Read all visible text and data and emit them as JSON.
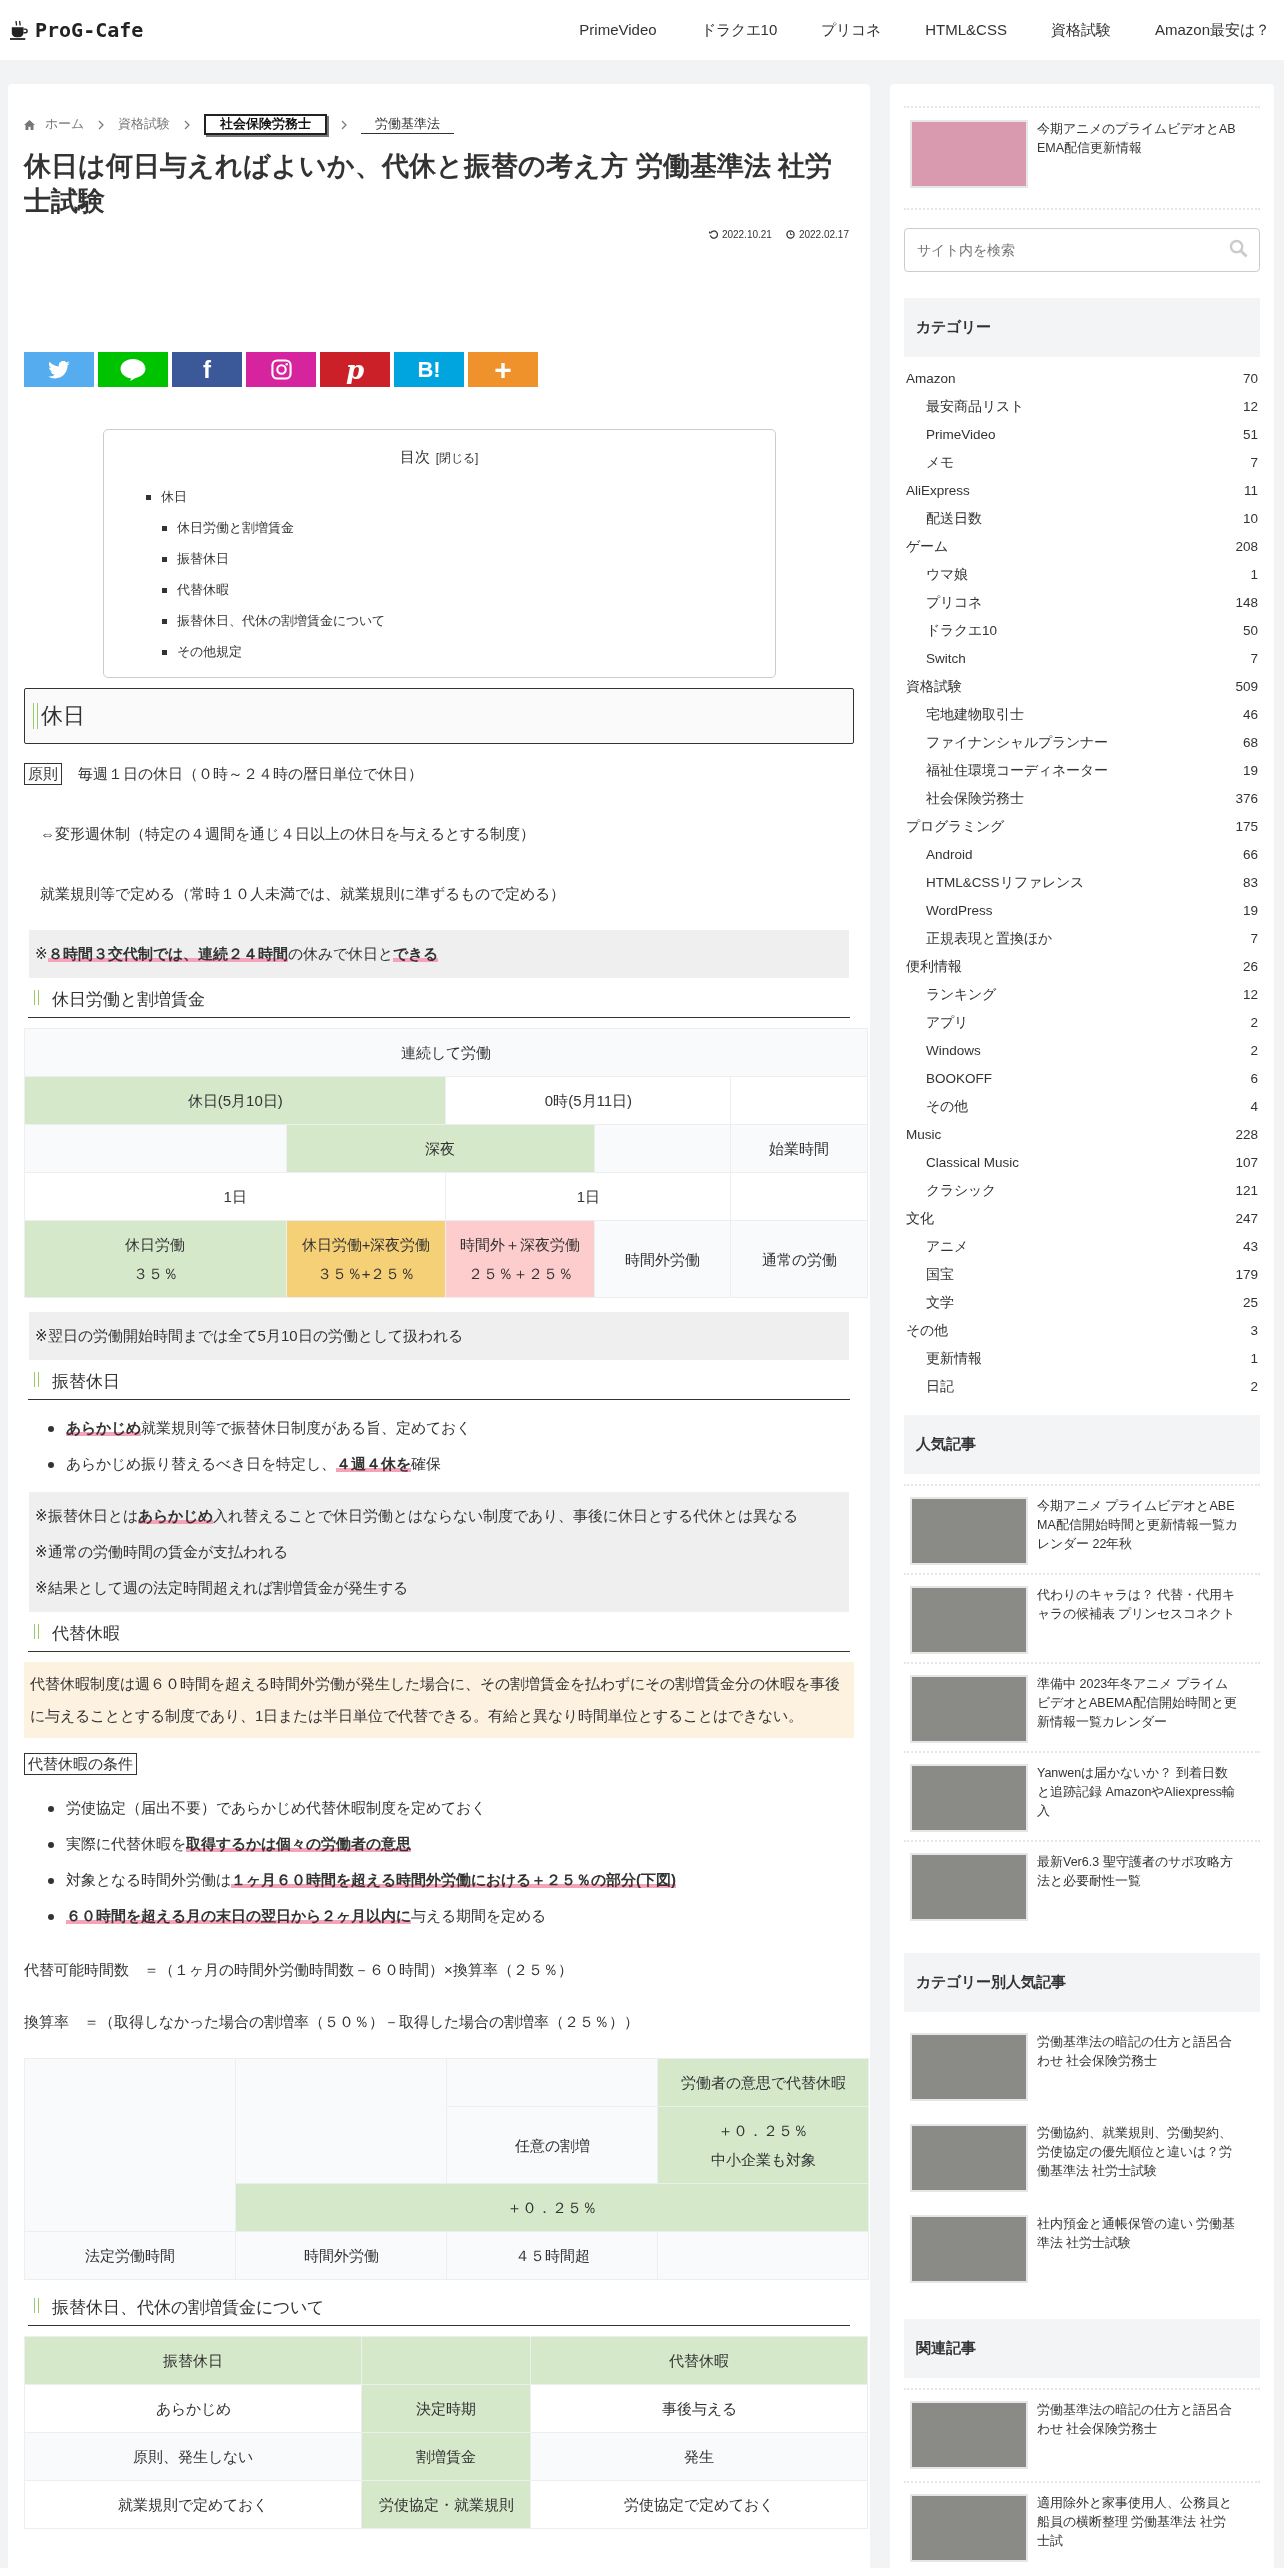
{
  "header": {
    "logo": "ProG-Cafe",
    "nav": [
      "PrimeVideo",
      "ドラクエ10",
      "プリコネ",
      "HTML&CSS",
      "資格試験",
      "Amazon最安は？"
    ]
  },
  "breadcrumb": [
    {
      "label": "ホーム",
      "kind": "home"
    },
    {
      "label": "資格試験",
      "kind": "plain"
    },
    {
      "label": "社会保険労務士",
      "kind": "boxed"
    },
    {
      "label": "労働基準法",
      "kind": "underlined"
    }
  ],
  "article": {
    "title": "休日は何日与えればよいか、代休と振替の考え方 労働基準法 社労士試験",
    "updated": "2022.10.21",
    "published": "2022.02.17",
    "share": [
      {
        "kind": "twitter",
        "color": "#55acee"
      },
      {
        "kind": "line",
        "color": "#00c300"
      },
      {
        "kind": "facebook",
        "color": "#3b5998",
        "label": "f"
      },
      {
        "kind": "instagram",
        "color": "#d6249f"
      },
      {
        "kind": "pinterest",
        "color": "#cb2027",
        "label": "p"
      },
      {
        "kind": "hatena",
        "color": "#00a4de",
        "label": "B!"
      },
      {
        "kind": "more",
        "color": "#f0922b",
        "label": "+"
      }
    ],
    "toc": {
      "title": "目次",
      "toggle": "[閉じる]",
      "items": [
        {
          "label": "休日",
          "children": [
            {
              "label": "休日労働と割増賃金"
            },
            {
              "label": "振替休日"
            },
            {
              "label": "代替休暇"
            },
            {
              "label": "振替休日、代休の割増賃金について"
            },
            {
              "label": "その他規定"
            }
          ]
        }
      ]
    },
    "content": [
      {
        "kind": "h2",
        "text": "休日"
      },
      {
        "kind": "p",
        "label": "原則",
        "text": "毎週１日の休日（０時～２４時の暦日単位で休日）"
      },
      {
        "kind": "indent",
        "text": "⇔変形週休制（特定の４週間を通じ４日以上の休日を与えるとする制度）"
      },
      {
        "kind": "indent",
        "text": "就業規則等で定める（常時１０人未満では、就業規則に準ずるもので定める）"
      },
      {
        "kind": "note",
        "lines": [
          "※**８時間３交代制では、連続２４時間**の休みで休日と**できる**"
        ]
      },
      {
        "kind": "h3",
        "text": "休日労働と割増賃金"
      },
      {
        "kind": "table",
        "rows": [
          [
            {
              "text": "連続して労働",
              "colspan": 5
            }
          ],
          [
            {
              "text": "休日(5月10日)",
              "colspan": 2,
              "color": "#d5e8ca"
            },
            {
              "text": "0時(5月11日)",
              "colspan": 2
            },
            {}
          ],
          [
            {},
            {
              "text": "深夜",
              "colspan": 2,
              "color": "#d5e8ca"
            },
            {},
            {
              "text": "始業時間"
            }
          ],
          [
            {
              "text": "1日",
              "colspan": 2
            },
            {
              "text": "1日",
              "colspan": 2
            },
            {}
          ],
          [
            {
              "lines": [
                "休日労働",
                "３５％"
              ],
              "color": "#d5e8ca"
            },
            {
              "lines": [
                "休日労働+深夜労働",
                "３５％+２５％"
              ],
              "color": "#f6d077"
            },
            {
              "lines": [
                "時間外＋深夜労働",
                "２５％＋２５％"
              ],
              "color": "#fdcccc"
            },
            {
              "text": "時間外労働"
            },
            {
              "text": "通常の労働"
            }
          ]
        ]
      },
      {
        "kind": "note",
        "lines": [
          "※翌日の労働開始時間までは全て5月10日の労働として扱われる"
        ]
      },
      {
        "kind": "h3",
        "text": "振替休日"
      },
      {
        "kind": "list",
        "items": [
          "**あらかじめ**就業規則等で振替休日制度がある旨、定めておく",
          "あらかじめ振り替えるべき日を特定し、**４週４休を**確保"
        ]
      },
      {
        "kind": "note",
        "lines": [
          "※振替休日とは**あらかじめ**入れ替えることで休日労働とはならない制度であり、事後に休日とする代休とは異なる",
          "※通常の労働時間の賃金が支払われる",
          "※結果として週の法定時間超えれば割増賃金が発生する"
        ]
      },
      {
        "kind": "h3",
        "text": "代替休暇"
      },
      {
        "kind": "box",
        "text": "代替休暇制度は週６０時間を超える時間外労働が発生した場合に、その割増賃金を払わずにその割増賃金分の休暇を事後に与えることとする制度であり、1日または半日単位で代替できる。有給と異なり時間単位とすることはできない。"
      },
      {
        "kind": "tag",
        "text": "代替休暇の条件"
      },
      {
        "kind": "list",
        "items": [
          "労使協定（届出不要）であらかじめ代替休暇制度を定めておく",
          "実際に代替休暇を**取得するかは個々の労働者の意思**",
          "対象となる時間外労働は**１ヶ月６０時間を超える時間外労働における＋２５％の部分(下図)**",
          "**６０時間を超える月の末日の翌日から２ヶ月以内に**与える期間を定める"
        ]
      },
      {
        "kind": "formula",
        "text": "代替可能時間数　＝（１ヶ月の時間外労働時間数－６０時間）×換算率（２５％）"
      },
      {
        "kind": "formula",
        "text": "換算率　＝（取得しなかった場合の割増率（５０％）－取得した場合の割増率（２５％））"
      },
      {
        "kind": "table",
        "rows": [
          [
            {
              "rowspan": 4
            },
            {
              "rowspan": 3
            },
            {
              "rowspan": 2
            },
            {
              "text": "労働者の意思で代替休暇",
              "color": "#d5e8ca"
            }
          ],
          [
            {
              "lines": [
                "＋０．２５％",
                "中小企業も対象"
              ],
              "rowspan": 2,
              "color": "#d5e8ca"
            }
          ],
          [
            {
              "text": "任意の割増"
            }
          ],
          [
            {
              "text": "＋０．２５％",
              "colspan": 3,
              "color": "#d5e8ca"
            }
          ],
          [
            {
              "text": "法定労働時間"
            },
            {
              "text": "時間外労働"
            },
            {
              "text": "４５時間超"
            },
            {}
          ]
        ]
      },
      {
        "kind": "h3",
        "text": "振替休日、代休の割増賃金について"
      },
      {
        "kind": "table",
        "rows": [
          [
            {
              "text": "振替休日",
              "color": "#d5e8ca"
            },
            {
              "color": "#d5e8ca"
            },
            {
              "text": "代替休暇",
              "color": "#d5e8ca"
            }
          ],
          [
            {
              "text": "あらかじめ"
            },
            {
              "text": "決定時期",
              "color": "#d5e8ca"
            },
            {
              "text": "事後与える"
            }
          ],
          [
            {
              "text": "原則、発生しない"
            },
            {
              "text": "割増賃金",
              "color": "#d5e8ca"
            },
            {
              "text": "発生"
            }
          ],
          [
            {
              "text": "就業規則で定めておく"
            },
            {
              "text": "労使協定・就業規則",
              "color": "#d5e8ca"
            },
            {
              "text": "労使協定で定めておく"
            }
          ]
        ]
      }
    ]
  },
  "sidebar": {
    "top_post": {
      "title": "今期アニメのプライムビデオとABEMA配信更新情報"
    },
    "search": {
      "placeholder": "サイト内を検索"
    },
    "categories": {
      "title": "カテゴリー",
      "items": [
        {
          "name": "Amazon",
          "count": "70",
          "children": [
            {
              "name": "最安商品リスト",
              "count": "12"
            },
            {
              "name": "PrimeVideo",
              "count": "51"
            },
            {
              "name": "メモ",
              "count": "7"
            }
          ]
        },
        {
          "name": "AliExpress",
          "count": "11",
          "children": [
            {
              "name": "配送日数",
              "count": "10"
            }
          ]
        },
        {
          "name": "ゲーム",
          "count": "208",
          "children": [
            {
              "name": "ウマ娘",
              "count": "1"
            },
            {
              "name": "プリコネ",
              "count": "148"
            },
            {
              "name": "ドラクエ10",
              "count": "50"
            },
            {
              "name": "Switch",
              "count": "7"
            }
          ]
        },
        {
          "name": "資格試験",
          "count": "509",
          "children": [
            {
              "name": "宅地建物取引士",
              "count": "46"
            },
            {
              "name": "ファイナンシャルプランナー",
              "count": "68"
            },
            {
              "name": "福祉住環境コーディネーター",
              "count": "19"
            },
            {
              "name": "社会保険労務士",
              "count": "376"
            }
          ]
        },
        {
          "name": "プログラミング",
          "count": "175",
          "children": [
            {
              "name": "Android",
              "count": "66"
            },
            {
              "name": "HTML&CSSリファレンス",
              "count": "83"
            },
            {
              "name": "WordPress",
              "count": "19"
            },
            {
              "name": "正規表現と置換ほか",
              "count": "7"
            }
          ]
        },
        {
          "name": "便利情報",
          "count": "26",
          "children": [
            {
              "name": "ランキング",
              "count": "12"
            },
            {
              "name": "アプリ",
              "count": "2"
            },
            {
              "name": "Windows",
              "count": "2"
            },
            {
              "name": "BOOKOFF",
              "count": "6"
            },
            {
              "name": "その他",
              "count": "4"
            }
          ]
        },
        {
          "name": "Music",
          "count": "228",
          "children": [
            {
              "name": "Classical Music",
              "count": "107"
            },
            {
              "name": "クラシック",
              "count": "121"
            }
          ]
        },
        {
          "name": "文化",
          "count": "247",
          "children": [
            {
              "name": "アニメ",
              "count": "43"
            },
            {
              "name": "国宝",
              "count": "179"
            },
            {
              "name": "文学",
              "count": "25"
            }
          ]
        },
        {
          "name": "その他",
          "count": "3",
          "children": [
            {
              "name": "更新情報",
              "count": "1"
            },
            {
              "name": "日記",
              "count": "2"
            }
          ]
        }
      ]
    },
    "popular": {
      "title": "人気記事",
      "items": [
        {
          "title": "今期アニメ プライムビデオとABEMA配信開始時間と更新情報一覧カレンダー 22年秋"
        },
        {
          "title": "代わりのキャラは？ 代替・代用キャラの候補表 プリンセスコネクト"
        },
        {
          "title": "準備中 2023年冬アニメ プライムビデオとABEMA配信開始時間と更新情報一覧カレンダー"
        },
        {
          "title": "Yanwenは届かないか？ 到着日数と追跡記録 AmazonやAliexpress輸入"
        },
        {
          "title": "最新Ver6.3 聖守護者のサポ攻略方法と必要耐性一覧"
        }
      ]
    },
    "category_popular": {
      "title": "カテゴリー別人気記事",
      "items": [
        {
          "title": "労働基準法の暗記の仕方と語呂合わせ 社会保険労務士"
        },
        {
          "title": "労働協約、就業規則、労働契約、労使協定の優先順位と違いは？労働基準法 社労士試験"
        },
        {
          "title": "社内預金と通帳保管の違い 労働基準法 社労士試験"
        }
      ]
    },
    "related": {
      "title": "関連記事",
      "items": [
        {
          "title": "労働基準法の暗記の仕方と語呂合わせ 社会保険労務士"
        },
        {
          "title": "適用除外と家事使用人、公務員と船員の横断整理 労働基準法 社労士試"
        }
      ]
    }
  }
}
